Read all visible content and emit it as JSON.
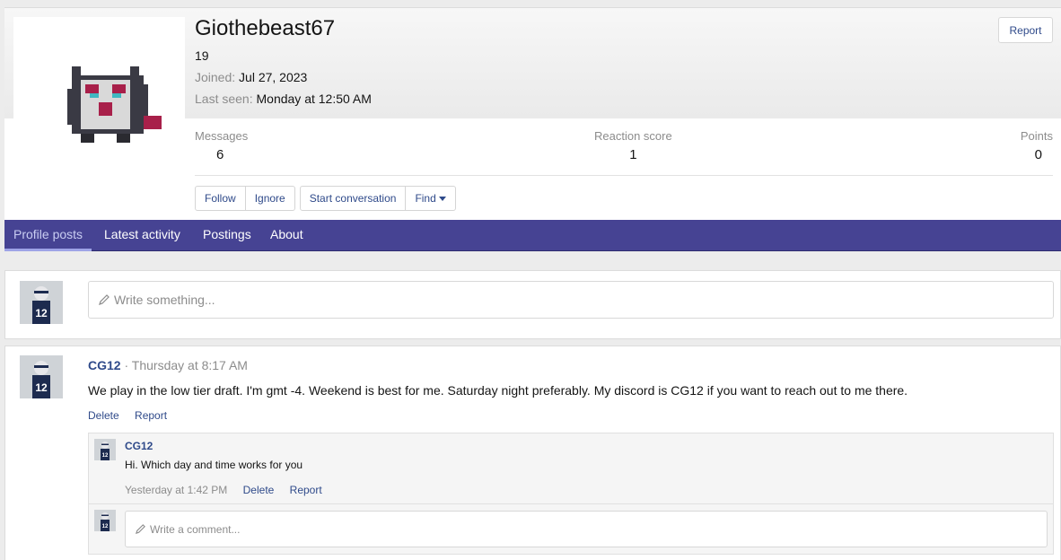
{
  "profile": {
    "username": "Giothebeast67",
    "user_title": "19",
    "joined_label": "Joined:",
    "joined_value": "Jul 27, 2023",
    "last_seen_label": "Last seen:",
    "last_seen_value": "Monday at 12:50 AM",
    "report_label": "Report",
    "stats": [
      {
        "label": "Messages",
        "value": "6"
      },
      {
        "label": "Reaction score",
        "value": "1"
      },
      {
        "label": "Points",
        "value": "0"
      }
    ],
    "buttons": {
      "follow": "Follow",
      "ignore": "Ignore",
      "start_conversation": "Start conversation",
      "find": "Find"
    },
    "avatar_icon": "gengar-sprite-icon"
  },
  "tabs": [
    {
      "label": "Profile posts",
      "active": true
    },
    {
      "label": "Latest activity",
      "active": false
    },
    {
      "label": "Postings",
      "active": false
    },
    {
      "label": "About",
      "active": false
    }
  ],
  "write": {
    "placeholder": "Write something..."
  },
  "post": {
    "author": "CG12",
    "separator": "·",
    "time": "Thursday at 8:17 AM",
    "body": "We play in the low tier draft. I'm gmt -4. Weekend is best for me. Saturday night preferably. My discord is CG12 if you want to reach out to me there.",
    "actions": {
      "delete": "Delete",
      "report": "Report"
    },
    "comment": {
      "author": "CG12",
      "body": "Hi. Which day and time works for you",
      "time": "Yesterday at 1:42 PM",
      "delete": "Delete",
      "report": "Report"
    },
    "comment_placeholder": "Write a comment..."
  },
  "colors": {
    "tab_bar": "#464393",
    "link": "#2f4a8a",
    "muted": "#8c8c8c"
  }
}
